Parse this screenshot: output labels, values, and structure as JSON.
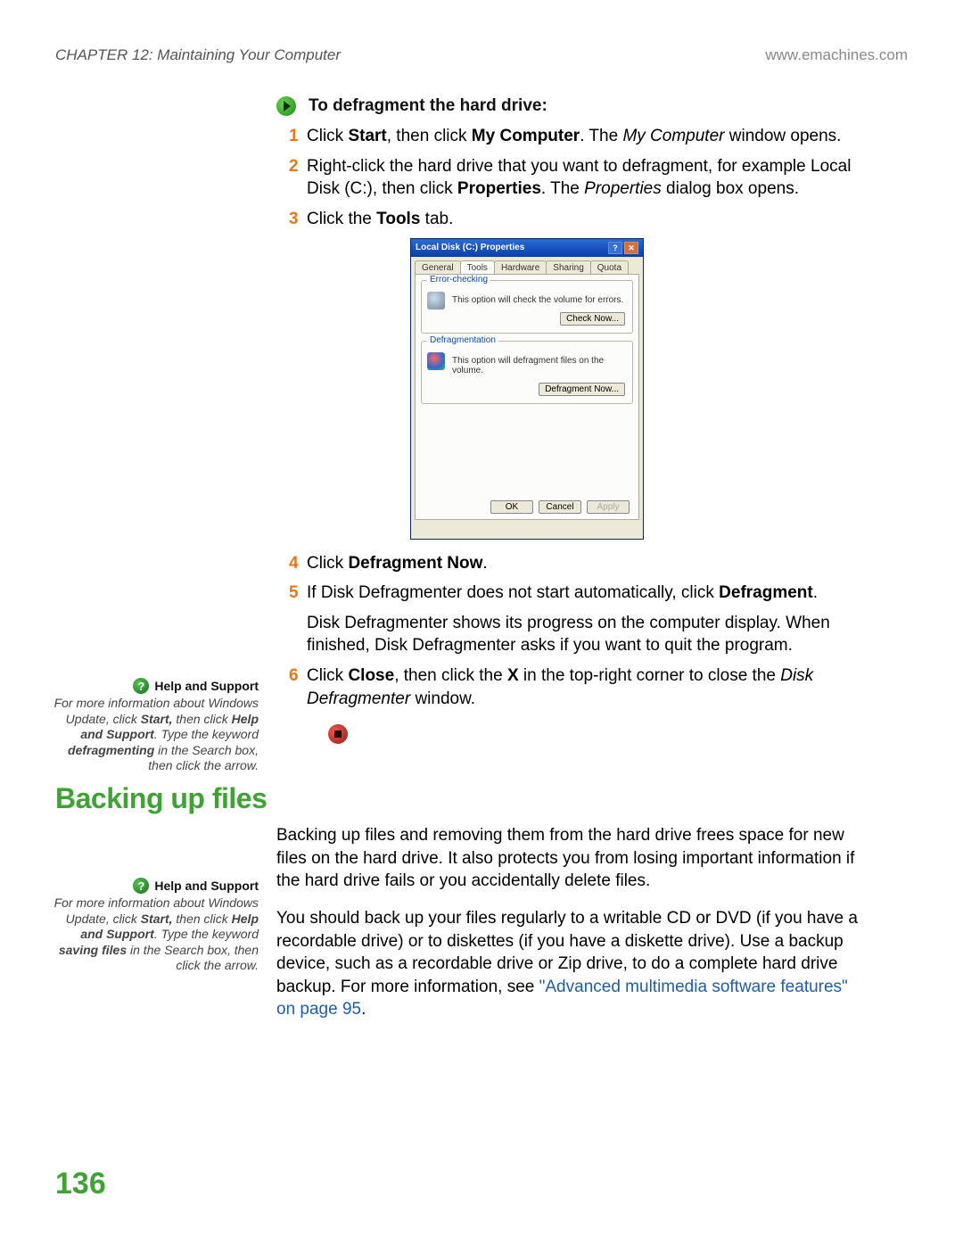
{
  "header": {
    "chapter": "CHAPTER 12: Maintaining Your Computer",
    "url": "www.emachines.com"
  },
  "procedure": {
    "title": "To defragment the hard drive:",
    "steps": {
      "1": {
        "label": "1",
        "pre": "Click ",
        "b1": "Start",
        "mid1": ", then click ",
        "b2": "My Computer",
        "mid2": ". The ",
        "i1": "My Computer",
        "post": " window opens."
      },
      "2": {
        "label": "2",
        "pre": "Right-click the hard drive that you want to defragment, for example Local Disk (C:), then click ",
        "b1": "Properties",
        "mid1": ". The ",
        "i1": "Properties",
        "post": " dialog box opens."
      },
      "3": {
        "label": "3",
        "pre": "Click the ",
        "b1": "Tools",
        "post": " tab."
      },
      "4": {
        "label": "4",
        "pre": "Click ",
        "b1": "Defragment Now",
        "post": "."
      },
      "5": {
        "label": "5",
        "pre": "If Disk Defragmenter does not start automatically, click ",
        "b1": "Defragment",
        "post": "."
      },
      "5p": "Disk Defragmenter shows its progress on the computer display. When finished, Disk Defragmenter asks if you want to quit the program.",
      "6": {
        "label": "6",
        "pre": "Click ",
        "b1": "Close",
        "mid1": ", then click the ",
        "b2": "X",
        "mid2": " in the top-right corner to close the ",
        "i1": "Disk Defragmenter",
        "post": " window."
      }
    }
  },
  "dialog": {
    "title": "Local Disk (C:) Properties",
    "help_btn": "?",
    "close_btn": "✕",
    "tabs": [
      "General",
      "Tools",
      "Hardware",
      "Sharing",
      "Quota"
    ],
    "selected_tab": "Tools",
    "group1": {
      "label": "Error-checking",
      "text": "This option will check the volume for errors.",
      "button": "Check Now..."
    },
    "group2": {
      "label": "Defragmentation",
      "text": "This option will defragment files on the volume.",
      "button": "Defragment Now..."
    },
    "ok": "OK",
    "cancel": "Cancel",
    "apply": "Apply"
  },
  "help1": {
    "title": "Help and Support",
    "l1_pre": "For more information about Windows Update, click ",
    "l1_b1": "Start,",
    "l1_mid": " then click ",
    "l1_b2": "Help and Support",
    "l1_post": ". Type the keyword ",
    "kw": "defragmenting",
    "tail": " in the Search box, then click the arrow."
  },
  "section": {
    "heading": "Backing up files",
    "p1": "Backing up files and removing them from the hard drive frees space for new files on the hard drive. It also protects you from losing important information if the hard drive fails or you accidentally delete files.",
    "p2_pre": "You should back up your files regularly to a writable CD or DVD (if you have a recordable drive) or to diskettes (if you have a diskette drive). Use a backup device, such as a recordable drive or Zip drive, to do a complete hard drive backup. For more information, see ",
    "p2_link": "\"Advanced multimedia software features\" on page 95",
    "p2_post": "."
  },
  "help2": {
    "title": "Help and Support",
    "l1_pre": "For more information about Windows Update, click ",
    "l1_b1": "Start,",
    "l1_mid": " then click ",
    "l1_b2": "Help and Support",
    "l1_post": ". Type the keyword ",
    "kw": "saving files",
    "tail": " in the Search box, then click the arrow."
  },
  "page_number": "136"
}
